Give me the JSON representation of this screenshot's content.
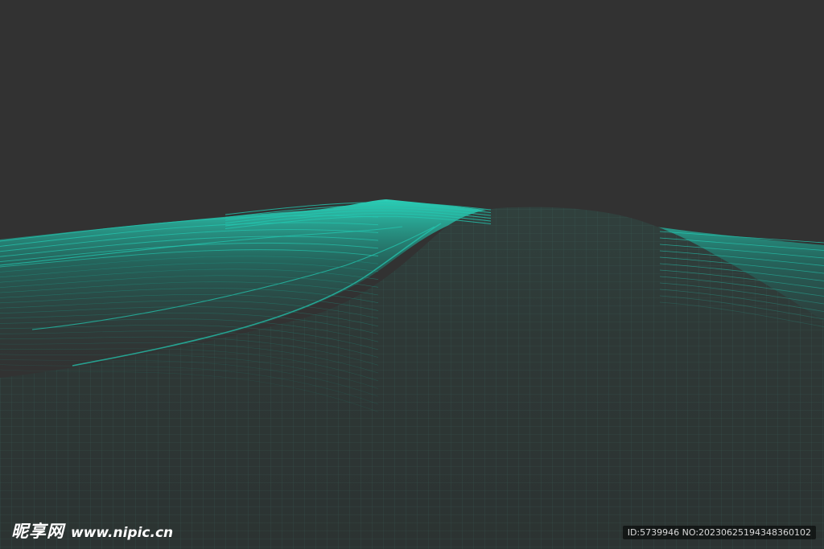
{
  "colors": {
    "background": "#323232",
    "terrain_fill": "#2c3634",
    "wire_glow": "#23c7b0",
    "wire_dim": "#1f8e7e"
  },
  "watermark": {
    "site_name": "昵享网",
    "url": "www.nipic.cn",
    "id_text": "ID:5739946 NO:20230625194348360102"
  }
}
